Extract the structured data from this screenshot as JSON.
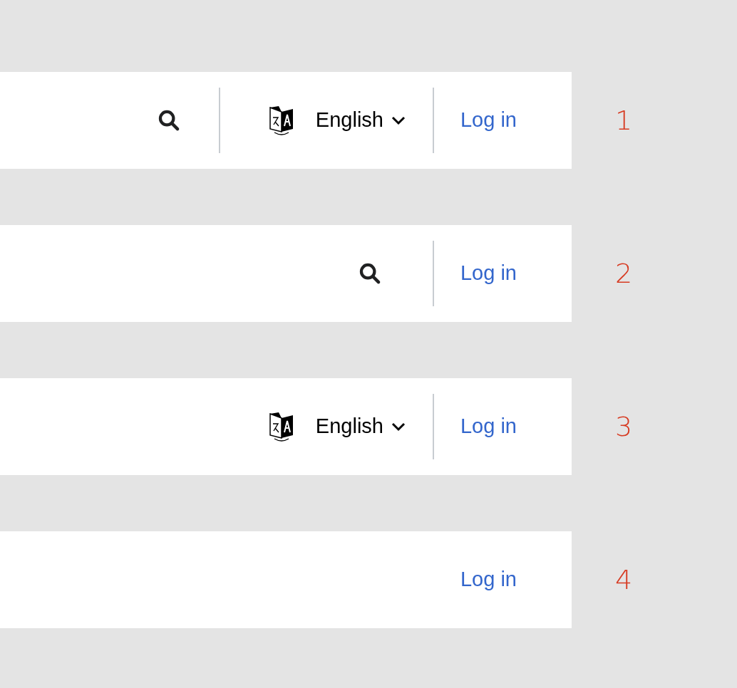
{
  "variants": [
    {
      "search": true,
      "language": {
        "label": "English"
      },
      "login": "Log in",
      "number": "1"
    },
    {
      "search": true,
      "login": "Log in",
      "number": "2"
    },
    {
      "search": false,
      "language": {
        "label": "English"
      },
      "login": "Log in",
      "number": "3"
    },
    {
      "search": false,
      "login": "Log in",
      "number": "4"
    }
  ]
}
